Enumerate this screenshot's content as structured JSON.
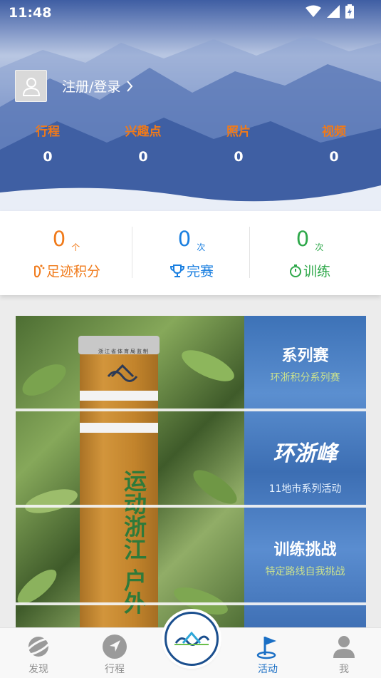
{
  "status_bar": {
    "time": "11:48"
  },
  "profile": {
    "login_label": "注册/登录"
  },
  "stats": [
    {
      "label": "行程",
      "value": "0"
    },
    {
      "label": "兴趣点",
      "value": "0"
    },
    {
      "label": "照片",
      "value": "0"
    },
    {
      "label": "视频",
      "value": "0"
    }
  ],
  "score": [
    {
      "value": "0",
      "unit": "个",
      "label": "足迹积分",
      "color": "#f07a1a",
      "icon": "footprint-icon"
    },
    {
      "value": "0",
      "unit": "次",
      "label": "完赛",
      "color": "#1a7fe0",
      "icon": "trophy-icon"
    },
    {
      "value": "0",
      "unit": "次",
      "label": "训练",
      "color": "#2ea84a",
      "icon": "stopwatch-icon"
    }
  ],
  "activities": [
    {
      "title": "系列赛",
      "subtitle": "环浙积分系列赛"
    },
    {
      "title": "环浙峰",
      "subtitle": "11地市系列活动"
    },
    {
      "title": "训练挑战",
      "subtitle": "特定路线自我挑战"
    }
  ],
  "post_text": "运动浙江 户外",
  "post_cap": "浙江省体育局监制",
  "tabs": [
    {
      "label": "发现",
      "icon": "planet-icon",
      "active": false
    },
    {
      "label": "行程",
      "icon": "navigation-icon",
      "active": false
    },
    {
      "label": "活动",
      "icon": "flag-icon",
      "active": true
    },
    {
      "label": "我",
      "icon": "person-icon",
      "active": false
    }
  ],
  "colors": {
    "accent_orange": "#f07a1a",
    "accent_blue": "#1a6fc5",
    "accent_green": "#2ea84a"
  }
}
